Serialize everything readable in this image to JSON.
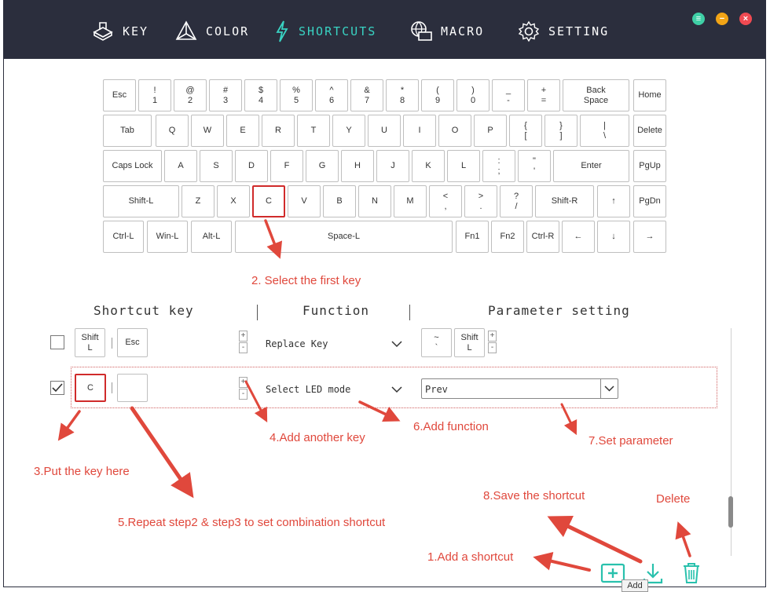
{
  "nav": [
    {
      "label": "KEY",
      "icon": "key-cap-icon"
    },
    {
      "label": "COLOR",
      "icon": "color-pyramid-icon"
    },
    {
      "label": "SHORTCUTS",
      "icon": "lightning-icon"
    },
    {
      "label": "MACRO",
      "icon": "monitor-globe-icon"
    },
    {
      "label": "SETTING",
      "icon": "gear-icon"
    }
  ],
  "window_buttons": [
    {
      "name": "menu",
      "symbol": "≡",
      "color": "#3fcfa6"
    },
    {
      "name": "minimize",
      "symbol": "−",
      "color": "#f2a416"
    },
    {
      "name": "close",
      "symbol": "×",
      "color": "#f04a52"
    }
  ],
  "keyboard": {
    "rows": [
      [
        [
          "Esc"
        ],
        [
          "!",
          "1"
        ],
        [
          "@",
          "2"
        ],
        [
          "#",
          "3"
        ],
        [
          "$",
          "4"
        ],
        [
          "%",
          "5"
        ],
        [
          "^",
          "6"
        ],
        [
          "&",
          "7"
        ],
        [
          "*",
          "8"
        ],
        [
          "(",
          "9"
        ],
        [
          ")",
          "0"
        ],
        [
          "_",
          "-"
        ],
        [
          "+",
          "="
        ],
        [
          "Back",
          "Space"
        ],
        [
          "Home"
        ]
      ],
      [
        [
          "Tab"
        ],
        [
          "Q"
        ],
        [
          "W"
        ],
        [
          "E"
        ],
        [
          "R"
        ],
        [
          "T"
        ],
        [
          "Y"
        ],
        [
          "U"
        ],
        [
          "I"
        ],
        [
          "O"
        ],
        [
          "P"
        ],
        [
          "{",
          "["
        ],
        [
          "}",
          "]"
        ],
        [
          "|",
          "\\"
        ],
        [
          "Delete"
        ]
      ],
      [
        [
          "Caps Lock"
        ],
        [
          "A"
        ],
        [
          "S"
        ],
        [
          "D"
        ],
        [
          "F"
        ],
        [
          "G"
        ],
        [
          "H"
        ],
        [
          "J"
        ],
        [
          "K"
        ],
        [
          "L"
        ],
        [
          ":",
          ";"
        ],
        [
          "\"",
          "'"
        ],
        [
          "Enter"
        ],
        [
          "PgUp"
        ]
      ],
      [
        [
          "Shift-L"
        ],
        [
          "Z"
        ],
        [
          "X"
        ],
        [
          "C"
        ],
        [
          "V"
        ],
        [
          "B"
        ],
        [
          "N"
        ],
        [
          "M"
        ],
        [
          "<",
          ","
        ],
        [
          ">",
          "."
        ],
        [
          "?",
          "/"
        ],
        [
          "Shift-R"
        ],
        [
          "↑"
        ],
        [
          "PgDn"
        ]
      ],
      [
        [
          "Ctrl-L"
        ],
        [
          "Win-L"
        ],
        [
          "Alt-L"
        ],
        [
          "Space-L"
        ],
        [
          "Fn1"
        ],
        [
          "Fn2"
        ],
        [
          "Ctrl-R"
        ],
        [
          "←"
        ],
        [
          "↓"
        ],
        [
          "→"
        ]
      ]
    ]
  },
  "table": {
    "headers": [
      "Shortcut key",
      "Function",
      "Parameter setting"
    ],
    "rows": [
      {
        "checked": false,
        "keys": [
          [
            "Shift",
            "L"
          ],
          [
            "Esc"
          ]
        ],
        "function": "Replace Key",
        "params": [
          [
            "~",
            "`"
          ],
          [
            "Shift",
            "L"
          ]
        ]
      },
      {
        "checked": true,
        "keys": [
          [
            "C"
          ],
          [
            ""
          ]
        ],
        "function": "Select LED mode",
        "param_value": "Prev"
      }
    ]
  },
  "annotations": {
    "a1": "1.Add a shortcut",
    "a2": "2. Select the first key",
    "a3": "3.Put the key here",
    "a4": "4.Add another key",
    "a5": "5.Repeat step2 & step3 to set combination shortcut",
    "a6": "6.Add function",
    "a7": "7.Set parameter",
    "a8": "8.Save the shortcut",
    "a9": "Delete"
  },
  "toolbar": {
    "add_tooltip": "Add"
  },
  "colors": {
    "topbar": "#2b2e3d",
    "active": "#39d3c3",
    "annotation": "#e0483c",
    "add": "#29c1ad"
  }
}
